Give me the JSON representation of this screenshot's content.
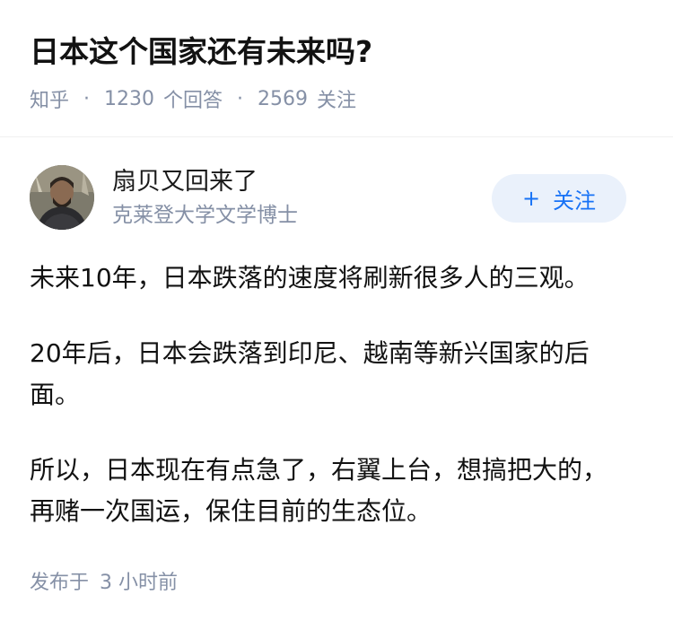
{
  "question": {
    "title": "日本这个国家还有未来吗?",
    "source": "知乎",
    "separator": "·",
    "answer_count": "1230",
    "answer_label": "个回答",
    "follow_count": "2569",
    "follow_label": "关注"
  },
  "author": {
    "name": "扇贝又回来了",
    "bio": "克莱登大学文学博士",
    "follow_button_icon": "+",
    "follow_button_label": "关注"
  },
  "answer": {
    "paragraphs": [
      "未来10年，日本跌落的速度将刷新很多人的三观。",
      "20年后，日本会跌落到印尼、越南等新兴国家的后面。",
      "所以，日本现在有点急了，右翼上台，想搞把大的，再赌一次国运，保住目前的生态位。"
    ],
    "time_prefix": "发布于",
    "time_value": "3 小时前"
  },
  "colors": {
    "accent": "#1772f6",
    "follow_bg": "#eaf1fb",
    "meta_gray": "#8590a6",
    "text": "#121212"
  }
}
